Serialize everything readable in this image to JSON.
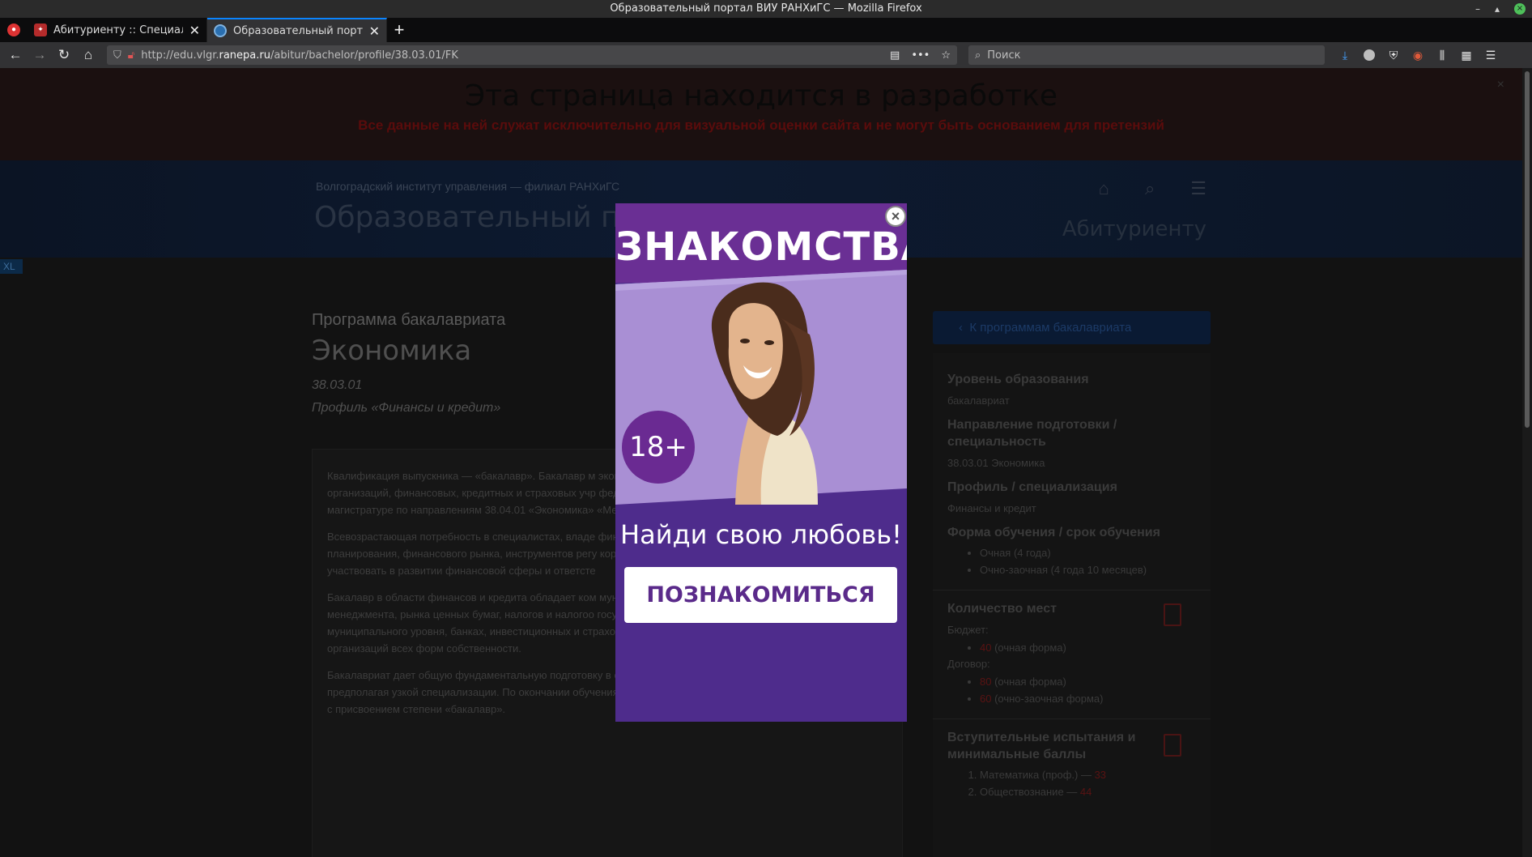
{
  "window": {
    "title": "Образовательный портал ВИУ РАНХиГС — Mozilla Firefox",
    "controls": [
      "–",
      "▴",
      "×"
    ]
  },
  "tabs": [
    {
      "title": "Абитуриенту :: Специалит",
      "close": "✕"
    },
    {
      "title": "Образовательный портал",
      "close": "✕"
    }
  ],
  "navbar": {
    "url_prefix": "http://edu.vlgr.",
    "url_host": "ranepa.ru",
    "url_path": "/abitur/bachelor/profile/38.03.01/FK",
    "search_placeholder": "Поиск"
  },
  "dev_banner": {
    "title": "Эта страница находится в разработке",
    "subtitle": "Все данные на ней служат исключительно для визуальной оценки сайта и не могут быть основанием для претензий",
    "close": "×"
  },
  "site": {
    "subtitle": "Волгоградский институт управления — филиал РАНХиГС",
    "title": "Образовательный порт",
    "right_link": "Абитуриенту",
    "badge": "XL"
  },
  "program": {
    "type": "Программа бакалавриата",
    "name": "Экономика",
    "code": "38.03.01",
    "profile": "Профиль «Финансы и кредит»"
  },
  "text_paragraphs": [
    "Квалификация выпускника — «бакалавр». Бакалавр м экономических, финансовых, маркетинговых, произво организаций, финансовых, кредитных и страховых учр федерального и муниципального уровня. Бакалавр под магистратуре по направлениям 38.04.01 «Экономика» «Менеджмент».",
    "Всевозрастающая потребность в специалистах, владе финансовых отношений, денежного обращения и кред планирования, финансового рынка, инструментов регу корпоративных финансов обусловили необходимость участвовать в развитии финансовой сферы и ответсте",
    "Бакалавр в области финансов и кредита обладает ком муниципальных финансов, банковского и страхового д менеджмента, рынка ценных бумаг, налогов и налогоо государственных органах федерального, регионального и муниципального уровня, банках, инвестиционных и страховых компаниях, экономических службах предприятий и организаций всех форм собственности.",
    "Бакалавриат дает общую фундаментальную подготовку в области знаний по выбранному направлению, не предполагая узкой специализации. По окончании обучения выпускнику выдается диплом о высшем образовании с присвоением степени «бакалавр»."
  ],
  "sidebar": {
    "back_button": "К программам бакалавриата",
    "level_title": "Уровень образования",
    "level_value": "бакалавриат",
    "direction_title": "Направление подготовки / специальность",
    "direction_value": "38.03.01 Экономика",
    "profile_title": "Профиль / специализация",
    "profile_value": "Финансы и кредит",
    "form_title": "Форма обучения / срок обучения",
    "forms": [
      "Очная (4 года)",
      "Очно-заочная (4 года 10 месяцев)"
    ],
    "seats_title": "Количество мест",
    "budget_label": "Бюджет:",
    "budget": [
      {
        "num": "40",
        "form": " (очная форма)"
      }
    ],
    "contract_label": "Договор:",
    "contract": [
      {
        "num": "80",
        "form": " (очная форма)"
      },
      {
        "num": "60",
        "form": " (очно-заочная форма)"
      }
    ],
    "exams_title": "Вступительные испытания и минимальные баллы",
    "exams": [
      {
        "name": "Математика (проф.) — ",
        "score": "33"
      },
      {
        "name": "Обществознание — ",
        "score": "44"
      }
    ]
  },
  "ad": {
    "headline": "ЗНАКОМСТВА",
    "age": "18+",
    "tagline": "Найди свою любовь!",
    "cta": "ПОЗНАКОМИТЬСЯ",
    "close": "×",
    "colors": {
      "top": "#6a2f94",
      "bottom": "#4e2c8c",
      "photo_bg": "#a98fd4"
    }
  }
}
